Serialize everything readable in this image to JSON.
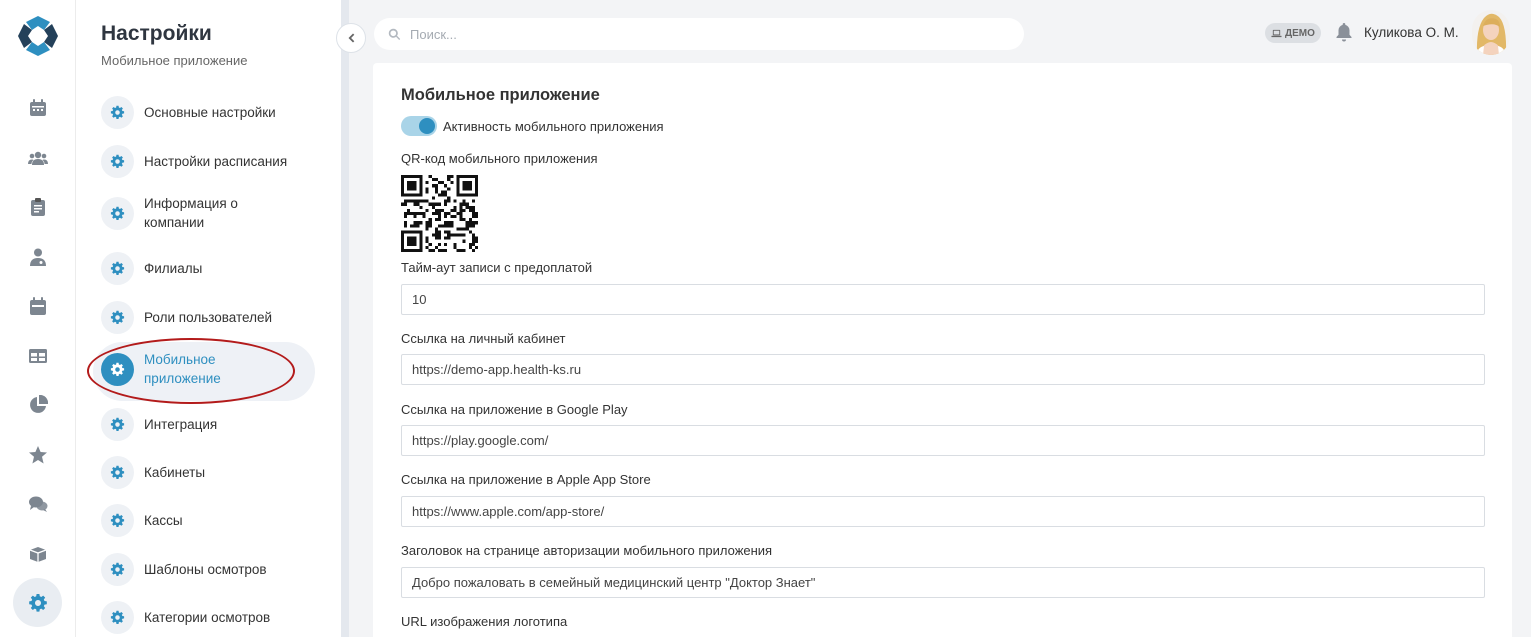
{
  "rail": {
    "items": [
      {
        "name": "calendar-icon"
      },
      {
        "name": "users-icon"
      },
      {
        "name": "clipboard-icon"
      },
      {
        "name": "doctor-icon"
      },
      {
        "name": "schedule-icon"
      },
      {
        "name": "table-icon"
      },
      {
        "name": "pie-chart-icon"
      },
      {
        "name": "star-icon"
      },
      {
        "name": "chat-icon"
      },
      {
        "name": "box-icon"
      }
    ],
    "active": "gear-icon"
  },
  "menu": {
    "title": "Настройки",
    "subtitle": "Мобильное приложение",
    "items": [
      {
        "label": "Основные настройки"
      },
      {
        "label": "Настройки расписания"
      },
      {
        "label": "Информация о компании"
      },
      {
        "label": "Филиалы"
      },
      {
        "label": "Роли пользователей"
      },
      {
        "label": "Мобильное приложение",
        "active": true
      },
      {
        "label": "Интеграция"
      },
      {
        "label": "Кабинеты"
      },
      {
        "label": "Кассы"
      },
      {
        "label": "Шаблоны осмотров"
      },
      {
        "label": "Категории осмотров"
      }
    ]
  },
  "header": {
    "search_placeholder": "Поиск...",
    "demo_badge": "ДЕМО",
    "user_name": "Куликова О. М."
  },
  "form": {
    "title": "Мобильное приложение",
    "toggle_label": "Активность мобильного приложения",
    "toggle_on": true,
    "qr_label": "QR-код мобильного приложения",
    "timeout_label": "Тайм-аут записи с предоплатой",
    "timeout_value": "10",
    "cabinet_label": "Ссылка на личный кабинет",
    "cabinet_value": "https://demo-app.health-ks.ru",
    "google_label": "Ссылка на приложение в Google Play",
    "google_value": "https://play.google.com/",
    "apple_label": "Ссылка на приложение в Apple App Store",
    "apple_value": "https://www.apple.com/app-store/",
    "header_label": "Заголовок на странице авторизации мобильного приложения",
    "header_value": "Добро пожаловать в семейный медицинский центр \"Доктор Знает\"",
    "logo_url_label": "URL изображения логотипа"
  },
  "colors": {
    "accent": "#2e8fc0",
    "annotation": "#b31b1b"
  }
}
